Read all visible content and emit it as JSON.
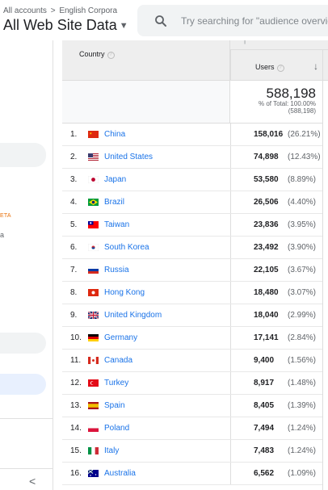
{
  "header": {
    "breadcrumb": [
      "All accounts",
      "English Corpora"
    ],
    "breadcrumb_sep": ">",
    "view_title": "All Web Site Data",
    "search_placeholder": "Try searching for \"audience overview\""
  },
  "sidebar": {
    "beta_label": "ETA",
    "mark": "a",
    "collapse_glyph": "<"
  },
  "table": {
    "country_header": "Country",
    "users_header": "Users",
    "help_glyph": "?",
    "sort_glyph": "↓",
    "total": {
      "value": "588,198",
      "pct_line": "% of Total: 100.00%",
      "abs_line": "(588,198)"
    },
    "rows": [
      {
        "idx": "1.",
        "country": "China",
        "users": "158,016",
        "pct": "(26.21%)",
        "flag": "cn"
      },
      {
        "idx": "2.",
        "country": "United States",
        "users": "74,898",
        "pct": "(12.43%)",
        "flag": "us"
      },
      {
        "idx": "3.",
        "country": "Japan",
        "users": "53,580",
        "pct": "(8.89%)",
        "flag": "jp"
      },
      {
        "idx": "4.",
        "country": "Brazil",
        "users": "26,506",
        "pct": "(4.40%)",
        "flag": "br"
      },
      {
        "idx": "5.",
        "country": "Taiwan",
        "users": "23,836",
        "pct": "(3.95%)",
        "flag": "tw"
      },
      {
        "idx": "6.",
        "country": "South Korea",
        "users": "23,492",
        "pct": "(3.90%)",
        "flag": "kr"
      },
      {
        "idx": "7.",
        "country": "Russia",
        "users": "22,105",
        "pct": "(3.67%)",
        "flag": "ru"
      },
      {
        "idx": "8.",
        "country": "Hong Kong",
        "users": "18,480",
        "pct": "(3.07%)",
        "flag": "hk"
      },
      {
        "idx": "9.",
        "country": "United Kingdom",
        "users": "18,040",
        "pct": "(2.99%)",
        "flag": "gb"
      },
      {
        "idx": "10.",
        "country": "Germany",
        "users": "17,141",
        "pct": "(2.84%)",
        "flag": "de"
      },
      {
        "idx": "11.",
        "country": "Canada",
        "users": "9,400",
        "pct": "(1.56%)",
        "flag": "ca"
      },
      {
        "idx": "12.",
        "country": "Turkey",
        "users": "8,917",
        "pct": "(1.48%)",
        "flag": "tr"
      },
      {
        "idx": "13.",
        "country": "Spain",
        "users": "8,405",
        "pct": "(1.39%)",
        "flag": "es"
      },
      {
        "idx": "14.",
        "country": "Poland",
        "users": "7,494",
        "pct": "(1.24%)",
        "flag": "pl"
      },
      {
        "idx": "15.",
        "country": "Italy",
        "users": "7,483",
        "pct": "(1.24%)",
        "flag": "it"
      },
      {
        "idx": "16.",
        "country": "Australia",
        "users": "6,562",
        "pct": "(1.09%)",
        "flag": "au"
      }
    ]
  },
  "colors": {
    "link": "#1a73e8",
    "header_bg": "#eeeeee",
    "search_bg": "#f1f3f4",
    "beta": "#e8710a"
  }
}
